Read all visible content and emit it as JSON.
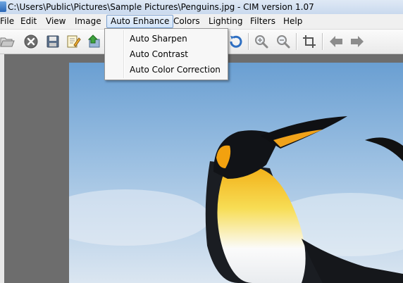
{
  "window": {
    "title": "C:\\Users\\Public\\Pictures\\Sample Pictures\\Penguins.jpg - CIM version 1.07"
  },
  "menubar": {
    "items": [
      {
        "label": "File"
      },
      {
        "label": "Edit"
      },
      {
        "label": "View"
      },
      {
        "label": "Image"
      },
      {
        "label": "Auto Enhance"
      },
      {
        "label": "Colors"
      },
      {
        "label": "Lighting"
      },
      {
        "label": "Filters"
      },
      {
        "label": "Help"
      }
    ]
  },
  "auto_enhance_menu": {
    "items": [
      {
        "label": "Auto Sharpen"
      },
      {
        "label": "Auto Contrast"
      },
      {
        "label": "Auto Color Correction"
      }
    ]
  },
  "toolbar": {
    "icons": [
      "open-icon",
      "close-icon",
      "save-icon",
      "edit-icon",
      "export-icon",
      "rotate-icon",
      "zoom-in-icon",
      "zoom-out-icon",
      "crop-icon",
      "back-arrow-icon",
      "forward-arrow-icon"
    ]
  },
  "colors": {
    "menu_highlight_border": "#7a9fcf",
    "workspace_bg": "#6d6d6d",
    "sky": "#8eb6dd"
  }
}
